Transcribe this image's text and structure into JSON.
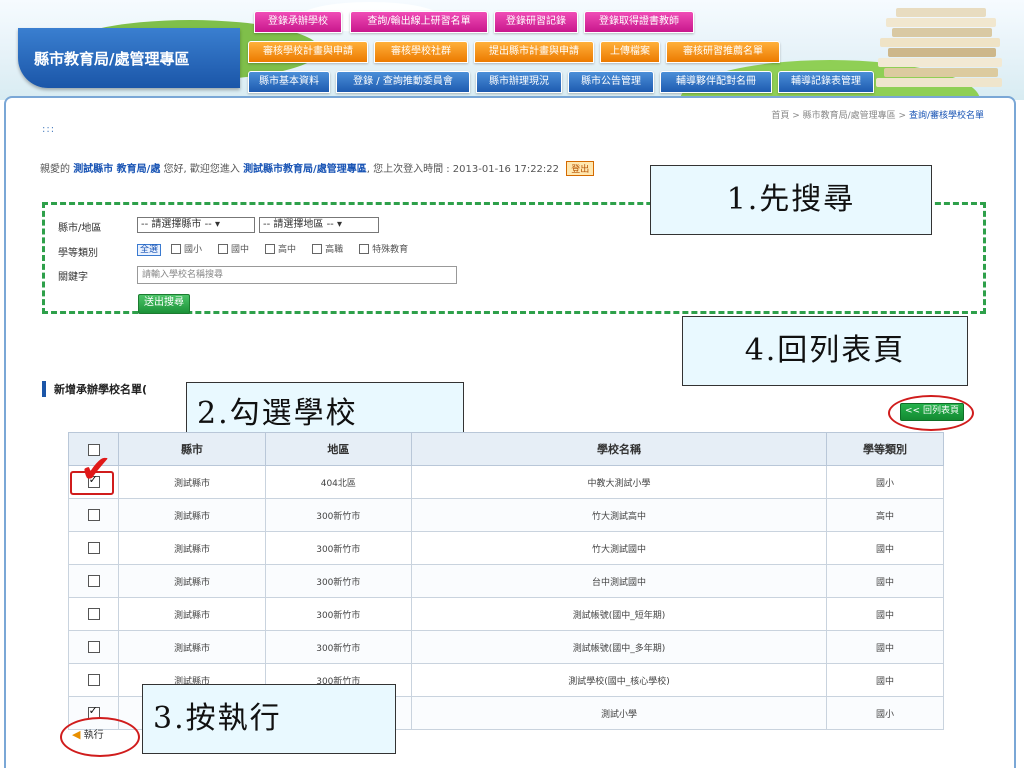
{
  "header": {
    "site_title": "縣市教育局/處管理專區",
    "tabs_row1": [
      "登錄承辦學校",
      "查詢/輸出線上研習名單",
      "登錄研習記錄",
      "登錄取得證書教師"
    ],
    "tabs_row2": [
      "審核學校計畫與申請",
      "審核學校社群",
      "提出縣市計畫與申請",
      "上傳檔案",
      "審核研習推薦名單"
    ],
    "tabs_row3": [
      "縣市基本資料",
      "登錄 / 查詢推動委員會",
      "縣市辦理現況",
      "縣市公告管理",
      "輔導夥伴配對名冊",
      "輔導記錄表管理"
    ]
  },
  "breadcrumb": {
    "path": "首頁 > 縣市教育局/處管理專區 > ",
    "current": "查詢/審核學校名單"
  },
  "welcome": {
    "prefix": "親愛的",
    "org": "測試縣市 教育局/處",
    "middle": "您好, 歡迎您進入",
    "area": "測試縣市教育局/處管理專區",
    "last_login": ", 您上次登入時間 : 2013-01-16 17:22:22",
    "logout": "登出"
  },
  "search": {
    "county_label": "縣市/地區",
    "county_select": "-- 請選擇縣市 --",
    "district_select": "-- 請選擇地區 --",
    "type_label": "學等類別",
    "type_all": "全選",
    "type_options": [
      "國小",
      "國中",
      "高中",
      "高職",
      "特殊教育"
    ],
    "keyword_label": "關鍵字",
    "keyword_placeholder": "請輸入學校名稱搜尋",
    "submit": "送出搜尋"
  },
  "callouts": {
    "step1": "1.先搜尋",
    "step2": "2.勾選學校",
    "step3": "3.按執行",
    "step4": "4.回列表頁"
  },
  "section_title": "新增承辦學校名單(",
  "back_button": "<< 回列表頁",
  "table": {
    "headers": [
      "",
      "縣市",
      "地區",
      "學校名稱",
      "學等類別"
    ],
    "rows": [
      {
        "checked": true,
        "county": "測試縣市",
        "district": "404北區",
        "school": "中教大測試小學",
        "type": "國小"
      },
      {
        "checked": false,
        "county": "測試縣市",
        "district": "300新竹市",
        "school": "竹大測試高中",
        "type": "高中"
      },
      {
        "checked": false,
        "county": "測試縣市",
        "district": "300新竹市",
        "school": "竹大測試國中",
        "type": "國中"
      },
      {
        "checked": false,
        "county": "測試縣市",
        "district": "300新竹市",
        "school": "台中測試國中",
        "type": "國中"
      },
      {
        "checked": false,
        "county": "測試縣市",
        "district": "300新竹市",
        "school": "測試帳號(國中_短年期)",
        "type": "國中"
      },
      {
        "checked": false,
        "county": "測試縣市",
        "district": "300新竹市",
        "school": "測試帳號(國中_多年期)",
        "type": "國中"
      },
      {
        "checked": false,
        "county": "測試縣市",
        "district": "300新竹市",
        "school": "測試學校(國中_核心學校)",
        "type": "國中"
      },
      {
        "checked": true,
        "county": "",
        "district": "",
        "school": "測試小學",
        "type": "國小"
      }
    ]
  },
  "execute": "執行",
  "colors": {
    "accent_blue": "#1b56a8",
    "tab_pink": "#c8178c",
    "tab_orange": "#ec7a00",
    "highlight_red": "#d01c1c",
    "dashed_green": "#2ea04a",
    "callout_bg": "#e9f9ff"
  }
}
